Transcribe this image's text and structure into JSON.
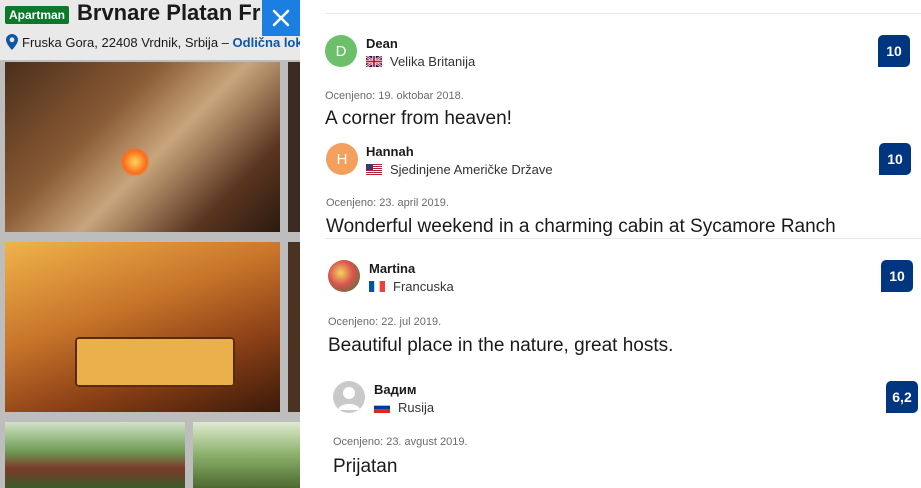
{
  "property": {
    "type_badge": "Apartman",
    "name": "Brvnare Platan Fr",
    "address": "Fruska Gora, 22408 Vrdnik, Srbija –",
    "location_link": "Odlična loka"
  },
  "modal": {
    "close_icon": "close-icon"
  },
  "reviews": [
    {
      "avatar_letter": "D",
      "avatar_color": "#6cc06a",
      "name": "Dean",
      "country": "Velika Britanija",
      "flag": "uk-flag-icon",
      "score": "10",
      "date": "Ocenjeno: 19. oktobar 2018.",
      "title": "A corner from heaven!"
    },
    {
      "avatar_letter": "H",
      "avatar_color": "#f2a05c",
      "name": "Hannah",
      "country": "Sjedinjene Američke Države",
      "flag": "us-flag-icon",
      "score": "10",
      "date": "Ocenjeno: 23. april 2019.",
      "title": "Wonderful weekend in a charming cabin at Sycamore Ranch"
    },
    {
      "avatar_letter": "",
      "avatar_color": "#c0392b",
      "name": "Martina",
      "country": "Francuska",
      "flag": "fr-flag-icon",
      "score": "10",
      "date": "Ocenjeno: 22. jul 2019.",
      "title": "Beautiful place in the nature, great hosts."
    },
    {
      "avatar_letter": "",
      "avatar_color": "#bfbfbf",
      "name": "Вадим",
      "country": "Rusija",
      "flag": "ru-flag-icon",
      "score": "6,2",
      "date": "Ocenjeno: 23. avgust 2019.",
      "title": "Prijatan"
    }
  ]
}
